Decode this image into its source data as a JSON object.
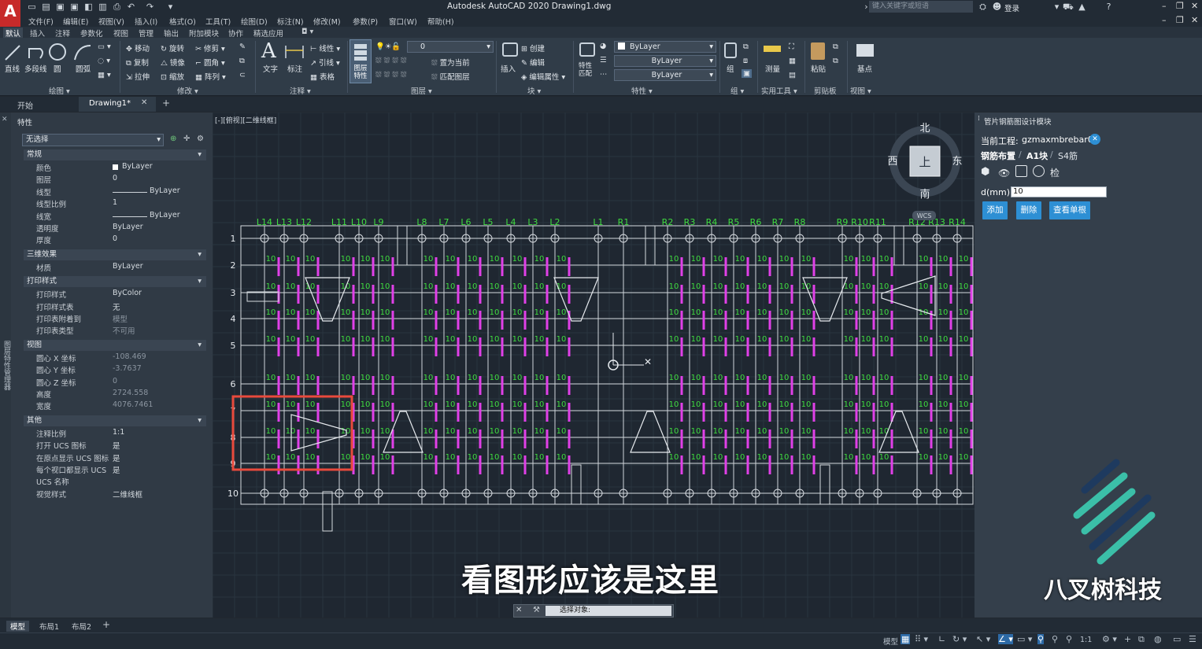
{
  "app": {
    "title": "Autodesk AutoCAD 2020   Drawing1.dwg",
    "logo": "A",
    "search_placeholder": "键入关键字或短语",
    "login": "登录",
    "menus": [
      "文件(F)",
      "编辑(E)",
      "视图(V)",
      "插入(I)",
      "格式(O)",
      "工具(T)",
      "绘图(D)",
      "标注(N)",
      "修改(M)",
      "参数(P)",
      "窗口(W)",
      "帮助(H)"
    ],
    "ribbon_tabs": [
      "默认",
      "插入",
      "注释",
      "参数化",
      "视图",
      "管理",
      "输出",
      "附加模块",
      "协作",
      "精选应用"
    ]
  },
  "ribbon": {
    "draw": {
      "label": "绘图 ▾",
      "line": "直线",
      "polyline": "多段线",
      "circle": "圆",
      "arc": "圆弧"
    },
    "modify": {
      "label": "修改 ▾",
      "move": "移动",
      "rotate": "旋转",
      "trim": "修剪",
      "copy": "复制",
      "mirror": "镜像",
      "fillet": "圆角",
      "stretch": "拉伸",
      "scale": "缩放",
      "array": "阵列"
    },
    "annotation": {
      "label": "注释 ▾",
      "text": "文字",
      "dim": "标注",
      "linear": "线性",
      "leader": "引线",
      "table": "表格"
    },
    "layers": {
      "label": "图层 ▾",
      "props": "图层\n特性",
      "current_layer": "0",
      "make_current": "置为当前",
      "match_layer": "匹配图层"
    },
    "block": {
      "label": "块 ▾",
      "insert": "插入",
      "create": "创建",
      "edit": "编辑",
      "edit_attr": "编辑属性"
    },
    "properties": {
      "label": "特性 ▾",
      "match": "特性\n匹配",
      "color": "ByLayer",
      "linetype": "ByLayer",
      "lineweight": "ByLayer"
    },
    "groups": {
      "label": "组 ▾",
      "group": "组"
    },
    "utilities": {
      "label": "实用工具 ▾",
      "measure": "测量"
    },
    "clipboard": {
      "label": "剪贴板",
      "paste": "粘贴"
    },
    "view": {
      "label": "视图 ▾",
      "base": "基点"
    }
  },
  "doc_tabs": {
    "start": "开始",
    "drawing": "Drawing1*"
  },
  "properties": {
    "title": "特性",
    "selection": "无选择",
    "groups": [
      {
        "name": "常规",
        "rows": [
          [
            "颜色",
            "ByLayer"
          ],
          [
            "图层",
            "0"
          ],
          [
            "线型",
            "ByLayer"
          ],
          [
            "线型比例",
            "1"
          ],
          [
            "线宽",
            "ByLayer"
          ],
          [
            "透明度",
            "ByLayer"
          ],
          [
            "厚度",
            "0"
          ]
        ]
      },
      {
        "name": "三维效果",
        "rows": [
          [
            "材质",
            "ByLayer"
          ]
        ]
      },
      {
        "name": "打印样式",
        "rows": [
          [
            "打印样式",
            "ByColor"
          ],
          [
            "打印样式表",
            "无"
          ],
          [
            "打印表附着到",
            "模型"
          ],
          [
            "打印表类型",
            "不可用"
          ]
        ]
      },
      {
        "name": "视图",
        "rows": [
          [
            "圆心 X 坐标",
            "-108.469"
          ],
          [
            "圆心 Y 坐标",
            "-3.7637"
          ],
          [
            "圆心 Z 坐标",
            "0"
          ],
          [
            "高度",
            "2724.558"
          ],
          [
            "宽度",
            "4076.7461"
          ]
        ]
      },
      {
        "name": "其他",
        "rows": [
          [
            "注释比例",
            "1:1"
          ],
          [
            "打开 UCS 图标",
            "是"
          ],
          [
            "在原点显示 UCS 图标",
            "是"
          ],
          [
            "每个视口都显示 UCS",
            "是"
          ],
          [
            "UCS 名称",
            ""
          ],
          [
            "视觉样式",
            "二维线框"
          ]
        ]
      }
    ],
    "side_label": "图层特性管理器"
  },
  "viewport": {
    "label": "[-][俯视][二维线框]",
    "compass": {
      "north": "北",
      "south": "南",
      "east": "东",
      "west": "西",
      "top": "上",
      "wcs": "WCS"
    },
    "column_labels": [
      "L14",
      "L13",
      "L12",
      "L11",
      "L10",
      "L9",
      "L8",
      "L7",
      "L6",
      "L5",
      "L4",
      "L3",
      "L2",
      "L1",
      "R1",
      "R2",
      "R3",
      "R4",
      "R5",
      "R6",
      "R7",
      "R8",
      "R9",
      "R10",
      "R11",
      "R12",
      "R13",
      "R14"
    ],
    "row_labels": [
      "1",
      "2",
      "3",
      "4",
      "5",
      "6",
      "7",
      "8",
      "9",
      "10"
    ],
    "rebar_value": "10",
    "subtitle": "看图形应该是这里",
    "command_prompt": "选择对象:"
  },
  "plugin": {
    "title": "管片钢筋图设计模块",
    "project_label": "当前工程:",
    "project_name": "gzmaxmbrebar01",
    "breadcrumb": [
      "钢筋布置",
      "A1块",
      "S4筋"
    ],
    "check": "检",
    "d_label": "d(mm)",
    "d_value": "10",
    "buttons": {
      "add": "添加",
      "delete": "删除",
      "view": "查看单根"
    }
  },
  "watermark": "八叉树科技",
  "layout_tabs": [
    "模型",
    "布局1",
    "布局2"
  ],
  "status": {
    "model": "模型",
    "scale": "1:1"
  },
  "colors": {
    "accent": "#2d8fd4",
    "rebar": "#e040e8",
    "label_green": "#3fdc3f",
    "highlight_box": "#e84a3c",
    "teal": "#3bbfa8",
    "navy": "#1e3a5f"
  }
}
